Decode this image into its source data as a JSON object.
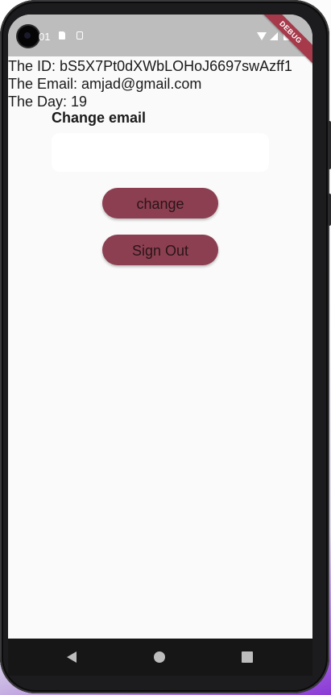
{
  "status_bar": {
    "time": "01"
  },
  "debug_banner": "DEBUG",
  "user_info": {
    "id_label": "The ID:",
    "id_value": "bS5X7Pt0dXWbLOHoJ6697swAzff1",
    "email_label": "The Email:",
    "email_value": "amjad@gmail.com",
    "day_label": "The Day:",
    "day_value": "19"
  },
  "change_email": {
    "label": "Change email",
    "value": "",
    "placeholder": ""
  },
  "buttons": {
    "change": "change",
    "sign_out": "Sign Out"
  },
  "colors": {
    "button_fill": "#8c3f51",
    "screen_background": "#fbfafa",
    "status_bar": "#bdbdbd",
    "debug_ribbon": "#a63a4b"
  },
  "icons": {
    "status_left": [
      "sd-card-icon",
      "sim-card-icon"
    ],
    "status_right": [
      "wifi-icon",
      "cell-signal-icon",
      "battery-icon"
    ],
    "navigation": [
      "back-icon",
      "home-icon",
      "recent-apps-icon"
    ]
  }
}
